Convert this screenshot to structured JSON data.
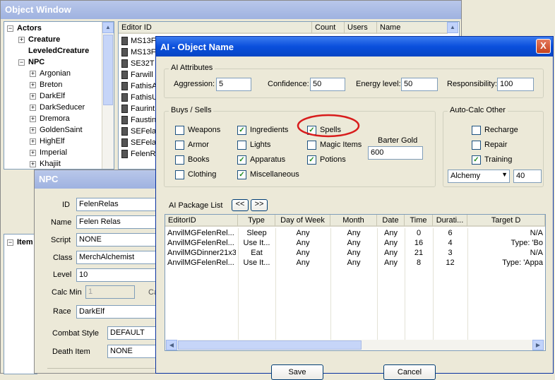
{
  "object_window": {
    "title": "Object Window",
    "tree": [
      {
        "label": "Actors",
        "pm": "−"
      },
      {
        "label": "Creature",
        "pm": "+"
      },
      {
        "label": "LeveledCreature",
        "pm": ""
      },
      {
        "label": "NPC",
        "pm": "−"
      },
      {
        "label": "Argonian",
        "pm": "+"
      },
      {
        "label": "Breton",
        "pm": "+"
      },
      {
        "label": "DarkElf",
        "pm": "+"
      },
      {
        "label": "DarkSeducer",
        "pm": "+"
      },
      {
        "label": "Dremora",
        "pm": "+"
      },
      {
        "label": "GoldenSaint",
        "pm": "+"
      },
      {
        "label": "HighElf",
        "pm": "+"
      },
      {
        "label": "Imperial",
        "pm": "+"
      },
      {
        "label": "Khajiit",
        "pm": "+"
      }
    ],
    "tree_items_label": "Item",
    "columns": {
      "editor_id": "Editor ID",
      "count": "Count",
      "users": "Users",
      "name": "Name"
    },
    "rows": [
      "MS13F",
      "MS13F",
      "SE32T",
      "Farwill",
      "FathisA",
      "FathisU",
      "Faurint",
      "Faustin",
      "SEFela",
      "SEFela",
      "FelenR"
    ]
  },
  "npc_window": {
    "title": "NPC",
    "id_label": "ID",
    "id_value": "FelenRelas",
    "name_label": "Name",
    "name_value": "Felen Relas",
    "script_label": "Script",
    "script_value": "NONE",
    "class_label": "Class",
    "class_value": "MerchAlchemist",
    "level_label": "Level",
    "level_value": "10",
    "calc_min_label": "Calc Min",
    "calc_min_value": "1",
    "calc_max_label": "Ca",
    "race_label": "Race",
    "race_value": "DarkElf",
    "combat_style_label": "Combat Style",
    "combat_style_value": "DEFAULT",
    "death_item_label": "Death Item",
    "death_item_value": "NONE"
  },
  "ai_window": {
    "title": "AI - Object Name",
    "close": "X",
    "attributes": {
      "group": "AI Attributes",
      "aggression_label": "Aggression:",
      "aggression": "5",
      "confidence_label": "Confidence:",
      "confidence": "50",
      "energy_label": "Energy level:",
      "energy": "50",
      "responsibility_label": "Responsibility:",
      "responsibility": "100"
    },
    "buys_sells": {
      "group": "Buys / Sells",
      "items": [
        {
          "label": "Weapons",
          "checked": false
        },
        {
          "label": "Armor",
          "checked": false
        },
        {
          "label": "Books",
          "checked": false
        },
        {
          "label": "Clothing",
          "checked": false
        },
        {
          "label": "Ingredients",
          "checked": true
        },
        {
          "label": "Lights",
          "checked": false
        },
        {
          "label": "Apparatus",
          "checked": true
        },
        {
          "label": "Miscellaneous",
          "checked": true
        },
        {
          "label": "Spells",
          "checked": true
        },
        {
          "label": "Magic Items",
          "checked": false
        },
        {
          "label": "Potions",
          "checked": true
        }
      ],
      "barter_label": "Barter Gold",
      "barter_value": "600"
    },
    "auto_calc": {
      "group": "Auto-Calc Other",
      "items": [
        {
          "label": "Recharge",
          "checked": false
        },
        {
          "label": "Repair",
          "checked": false
        },
        {
          "label": "Training",
          "checked": true
        }
      ],
      "skill": "Alchemy",
      "skill_value": "40"
    },
    "package": {
      "label": "AI Package List",
      "prev": "<<",
      "next": ">>",
      "columns": [
        "EditorID",
        "Type",
        "Day of Week",
        "Month",
        "Date",
        "Time",
        "Durati...",
        "Target D"
      ],
      "rows": [
        [
          "AnvilMGFelenRel...",
          "Sleep",
          "Any",
          "Any",
          "Any",
          "0",
          "6",
          "N/A"
        ],
        [
          "AnvilMGFelenRel...",
          "Use It...",
          "Any",
          "Any",
          "Any",
          "16",
          "4",
          "Type: 'Bo"
        ],
        [
          "AnvilMGDinner21x3",
          "Eat",
          "Any",
          "Any",
          "Any",
          "21",
          "3",
          "N/A"
        ],
        [
          "AnvilMGFelenRel...",
          "Use It...",
          "Any",
          "Any",
          "Any",
          "8",
          "12",
          "Type: 'Appa"
        ]
      ]
    },
    "save": "Save",
    "cancel": "Cancel"
  },
  "colors": {
    "annotation": "#d81c1c",
    "title_active": "#0a4fdc",
    "title_inactive": "#b9c7ea"
  }
}
